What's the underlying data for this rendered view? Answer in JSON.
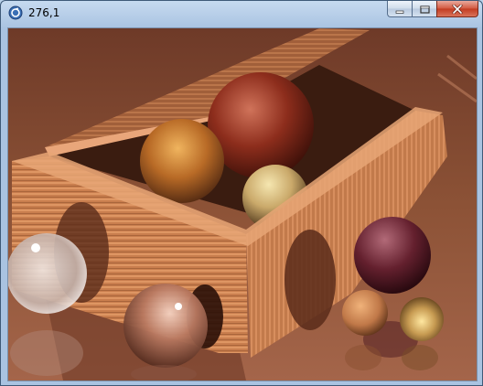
{
  "window": {
    "title": "276,1",
    "icon": "app-icon",
    "buttons": [
      "minimize-icon",
      "maximize-icon",
      "close-icon"
    ]
  },
  "scene": {
    "description_visible": false,
    "colors": {
      "floor": "#8a5238",
      "wood_light": "#d98c5c",
      "wood_dark": "#6b3520",
      "sphere_red": "#8a2a1a",
      "sphere_purple": "#5a1e28",
      "glass": "#d8d0cc"
    }
  }
}
